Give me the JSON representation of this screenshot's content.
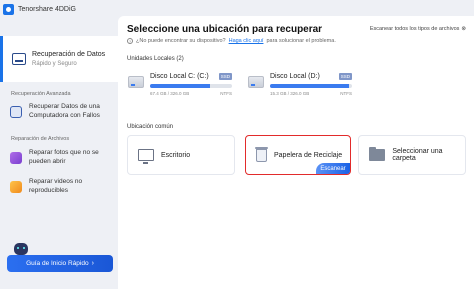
{
  "app": {
    "title": "Tenorshare 4DDiG"
  },
  "sidebar": {
    "main_item": {
      "title": "Recuperación de Datos",
      "subtitle": "Rápido y Seguro"
    },
    "advanced": {
      "label": "Recuperación Avanzada",
      "item": {
        "line1": "Recuperar Datos de una",
        "line2": "Computadora con Fallos"
      }
    },
    "repair": {
      "label": "Reparación de Archivos",
      "photos": {
        "line1": "Reparar fotos que no se",
        "line2": "pueden abrir"
      },
      "videos": {
        "line1": "Reparar videos no",
        "line2": "reproducibles"
      }
    },
    "guide_button": "Guía de Inicio Rápido",
    "guide_arrow": "›"
  },
  "main": {
    "title": "Seleccione una ubicación para recuperar",
    "help_text": "¿No puede encontrar su dispositivo?",
    "help_link": "Haga clic aquí",
    "help_suffix": "para solucionar el problema.",
    "scan_all": "Escanear todos los tipos de archivos",
    "scan_all_icon": "⊗"
  },
  "local_drives": {
    "label": "Unidades Locales (2)",
    "drives": [
      {
        "name": "Disco Local C: (C:)",
        "badge": "SSD",
        "usage": "67.4 GB / 326.0 GB",
        "fs": "NTFS",
        "used_fraction": 0.73
      },
      {
        "name": "Disco Local (D:)",
        "badge": "SSD",
        "usage": "15.3 GB / 326.0 GB",
        "fs": "NTFS",
        "used_fraction": 0.96
      }
    ]
  },
  "common_locations": {
    "label": "Ubicación común",
    "desktop": "Escritorio",
    "recycle_bin": "Papelera de Reciclaje",
    "select_folder": "Seleccionar una carpeta",
    "scan_button": "Escanear"
  },
  "colors": {
    "accent": "#1a73e8",
    "selected_border": "#e22b2b"
  }
}
